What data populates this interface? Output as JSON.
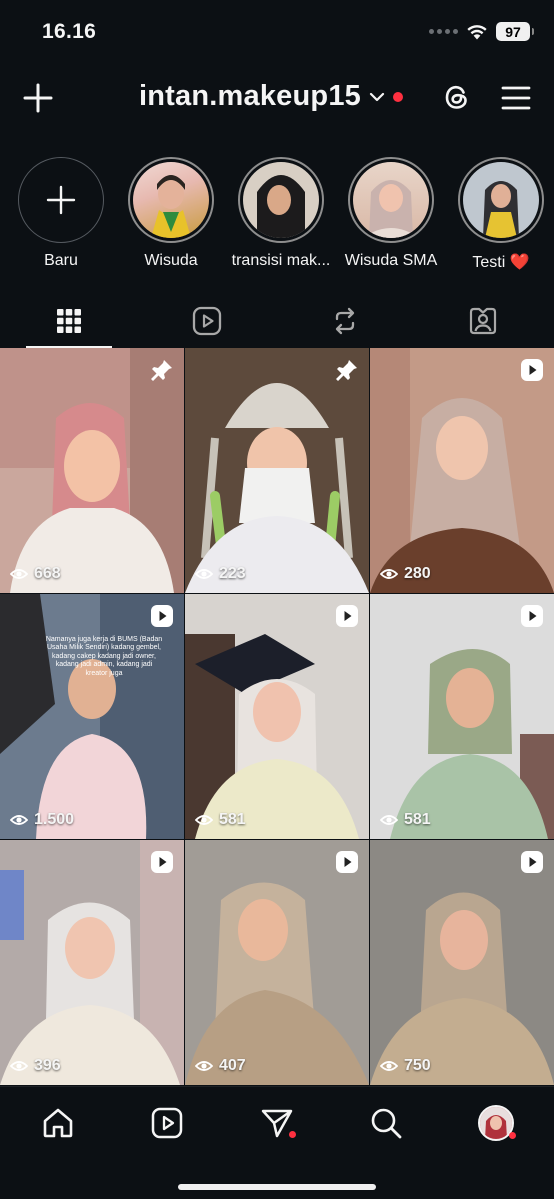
{
  "status_bar": {
    "time": "16.16",
    "battery": "97"
  },
  "header": {
    "username": "intan.makeup15"
  },
  "highlights": [
    {
      "label": "Baru"
    },
    {
      "label": "Wisuda"
    },
    {
      "label": "transisi mak..."
    },
    {
      "label": "Wisuda SMA"
    },
    {
      "label": "Testi ❤️"
    }
  ],
  "posts": [
    {
      "views": "668",
      "type": "pinned"
    },
    {
      "views": "223",
      "type": "pinned"
    },
    {
      "views": "280",
      "type": "reel"
    },
    {
      "views": "1.500",
      "type": "reel",
      "overlay": "Namanya juga kerja di BUMS (Badan Usaha Milik Sendiri) kadang gembel, kadang cakep kadang jadi owner, kadang jadi admin, kadang jadi kreator juga"
    },
    {
      "views": "581",
      "type": "reel"
    },
    {
      "views": "581",
      "type": "reel"
    },
    {
      "views": "396",
      "type": "reel"
    },
    {
      "views": "407",
      "type": "reel"
    },
    {
      "views": "750",
      "type": "reel"
    }
  ],
  "colors": {
    "background": "#0c1014",
    "text": "#f5f5f5",
    "notification": "#ff3040"
  }
}
